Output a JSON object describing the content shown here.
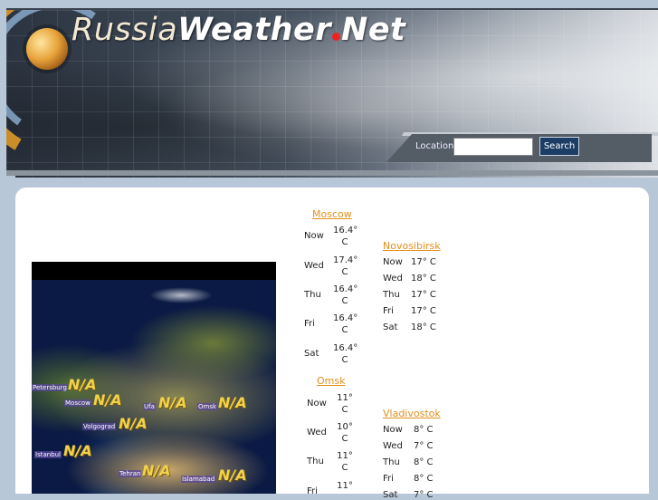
{
  "header": {
    "title_part1": "Russia",
    "title_part2": "Weather",
    "title_part3": "Net",
    "location_label": "Location",
    "location_value": "",
    "search_label": "Search"
  },
  "map": {
    "cities": [
      {
        "name": "Petersburg",
        "value": "N/A"
      },
      {
        "name": "Moscow",
        "value": "N/A"
      },
      {
        "name": "Ufa",
        "value": "N/A"
      },
      {
        "name": "Omsk",
        "value": "N/A"
      },
      {
        "name": "Volgograd",
        "value": "N/A"
      },
      {
        "name": "Istanbul",
        "value": "N/A"
      },
      {
        "name": "Tehran",
        "value": "N/A"
      },
      {
        "name": "Islamabad",
        "value": "N/A"
      }
    ]
  },
  "forecasts": {
    "moscow": {
      "city": "Moscow",
      "days": [
        {
          "day": "Now",
          "temp": "16.4°",
          "unit": "C"
        },
        {
          "day": "Wed",
          "temp": "17.4°",
          "unit": "C"
        },
        {
          "day": "Thu",
          "temp": "16.4°",
          "unit": "C"
        },
        {
          "day": "Fri",
          "temp": "16.4°",
          "unit": "C"
        },
        {
          "day": "Sat",
          "temp": "16.4°",
          "unit": "C"
        }
      ]
    },
    "omsk": {
      "city": "Omsk",
      "days": [
        {
          "day": "Now",
          "temp": "11°",
          "unit": "C"
        },
        {
          "day": "Wed",
          "temp": "10°",
          "unit": "C"
        },
        {
          "day": "Thu",
          "temp": "11°",
          "unit": "C"
        },
        {
          "day": "Fri",
          "temp": "11°",
          "unit": ""
        }
      ]
    },
    "novosibirsk": {
      "city": "Novosibirsk",
      "days": [
        {
          "day": "Now",
          "temp": "17° C"
        },
        {
          "day": "Wed",
          "temp": "18° C"
        },
        {
          "day": "Thu",
          "temp": "17° C"
        },
        {
          "day": "Fri",
          "temp": "17° C"
        },
        {
          "day": "Sat",
          "temp": "18° C"
        }
      ]
    },
    "vladivostok": {
      "city": "Vladivostok",
      "days": [
        {
          "day": "Now",
          "temp": "8° C"
        },
        {
          "day": "Wed",
          "temp": "7° C"
        },
        {
          "day": "Thu",
          "temp": "8° C"
        },
        {
          "day": "Fri",
          "temp": "8° C"
        },
        {
          "day": "Sat",
          "temp": "7° C"
        }
      ]
    }
  }
}
